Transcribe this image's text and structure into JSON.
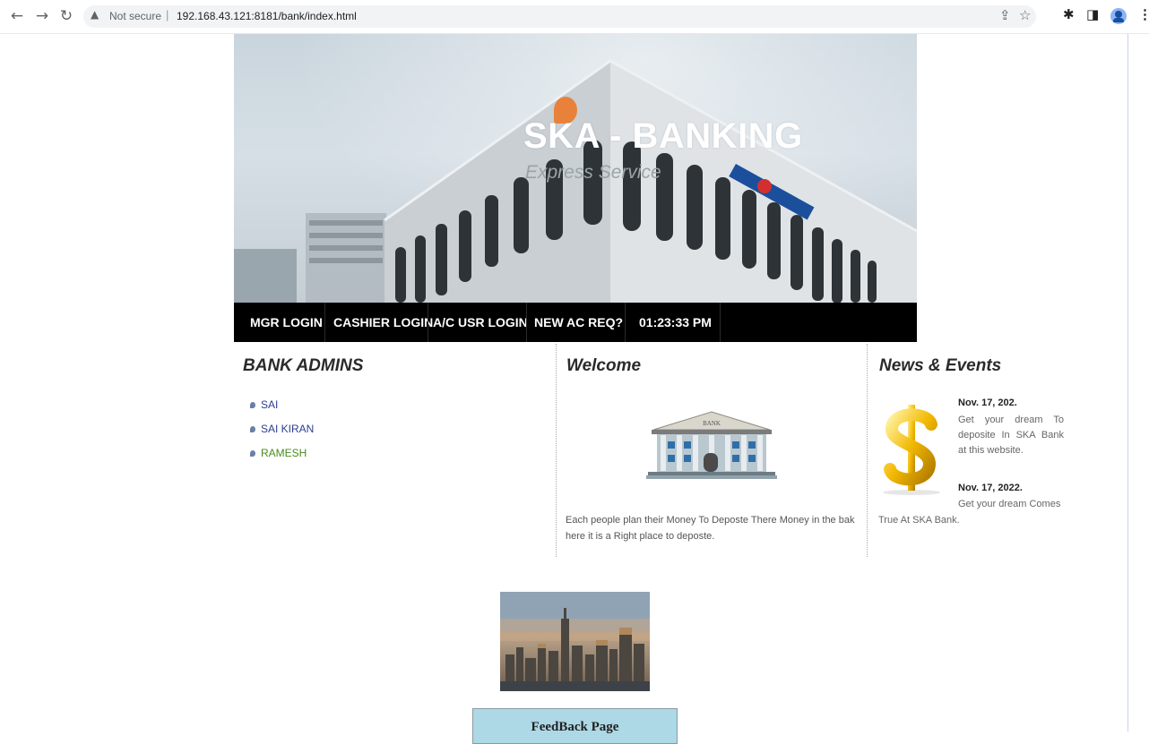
{
  "browser": {
    "security_label": "Not secure",
    "url": "192.168.43.121:8181/bank/index.html"
  },
  "header": {
    "title": "SKA - BANKING",
    "subtitle": "Express Service"
  },
  "nav": {
    "items": [
      "MGR LOGIN",
      "CASHIER LOGIN",
      "A/C USR LOGIN",
      "NEW AC REQ?"
    ],
    "clock": "01:23:33 PM"
  },
  "admins": {
    "title": "BANK ADMINS",
    "items": [
      "SAI",
      "SAI KIRAN",
      "RAMESH"
    ]
  },
  "welcome": {
    "title": "Welcome",
    "bank_sign": "BANK",
    "text": "Each people plan their Money To Deposte There Money in the bak here it is a Right place to deposte."
  },
  "news": {
    "title": "News & Events",
    "items": [
      {
        "date": "Nov. 17, 202.",
        "text": "Get your dream To deposite In SKA Bank at this website."
      },
      {
        "date": "Nov. 17, 2022.",
        "text": "Get your dream Comes"
      }
    ],
    "tail": "True At SKA Bank."
  },
  "feedback": {
    "label": "FeedBack Page"
  }
}
